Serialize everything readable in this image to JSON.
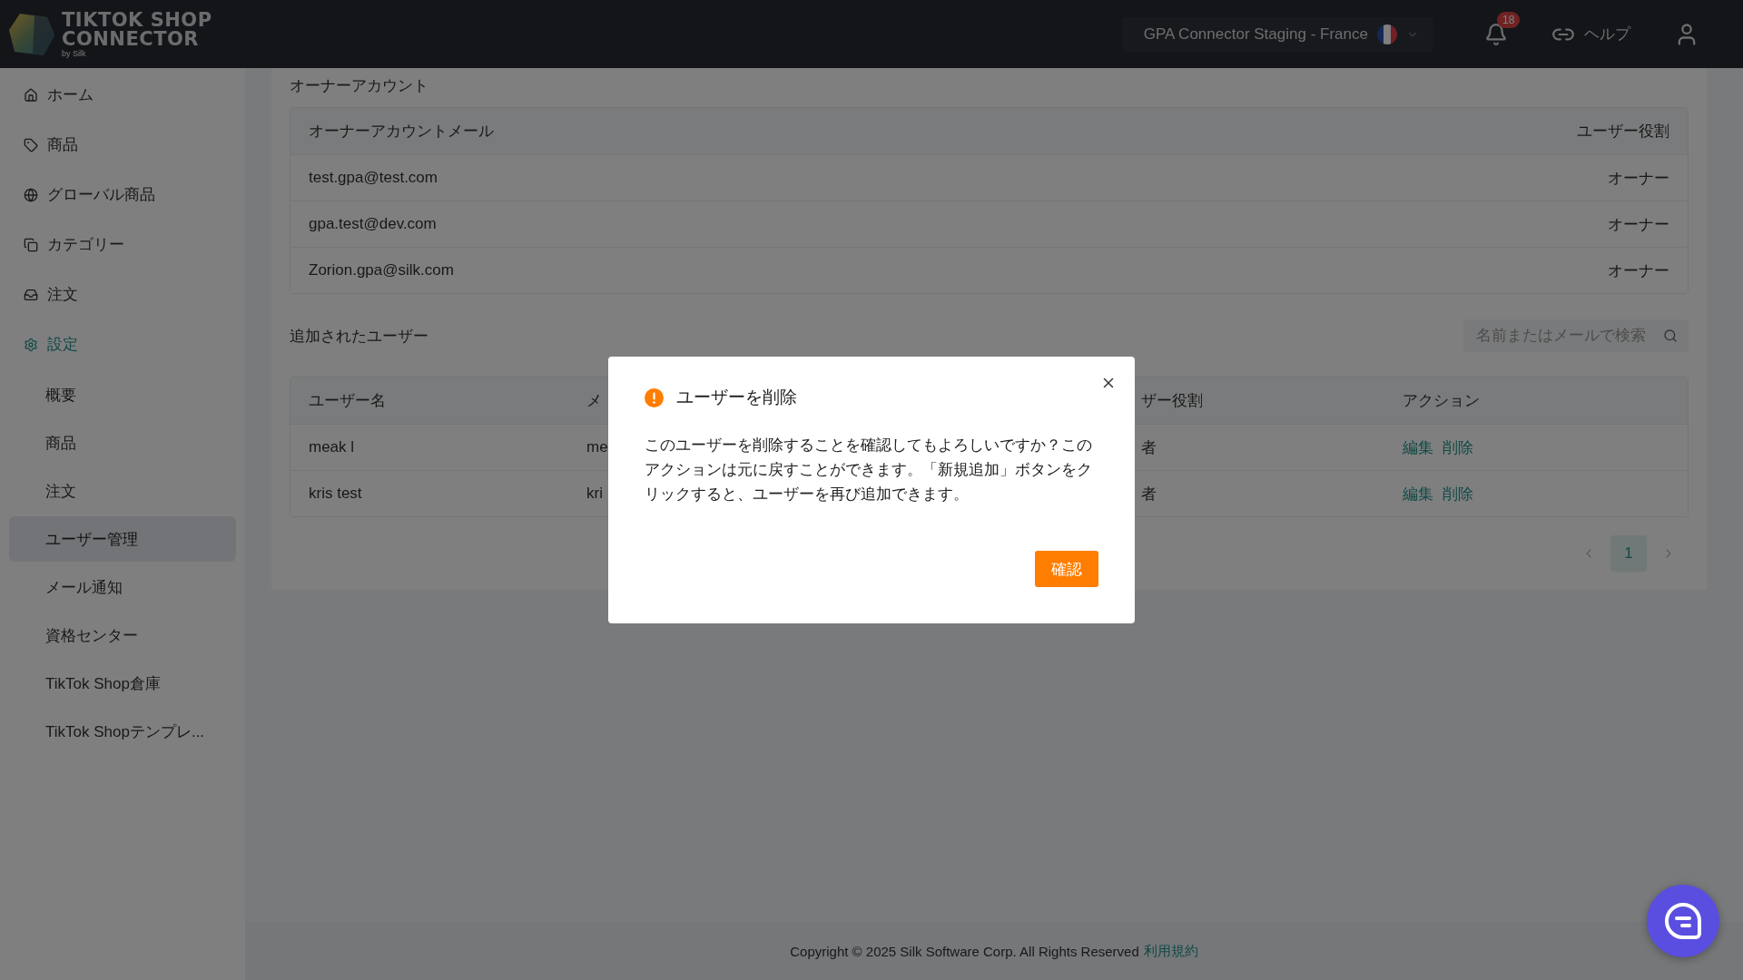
{
  "header": {
    "logo": {
      "line1": "TIKTOK SHOP",
      "line2": "CONNECTOR",
      "tagline": "by Silk"
    },
    "store_selector": {
      "name": "GPA Connector Staging",
      "separator": "-",
      "country": "France"
    },
    "notifications": {
      "count": "18"
    },
    "help": {
      "label": "ヘルプ"
    }
  },
  "sidebar": {
    "items": [
      {
        "label": "ホーム",
        "selected": false
      },
      {
        "label": "商品",
        "selected": false
      },
      {
        "label": "グローバル商品",
        "selected": false
      },
      {
        "label": "カテゴリー",
        "selected": false
      },
      {
        "label": "注文",
        "selected": false
      },
      {
        "label": "設定",
        "selected": true,
        "children": [
          {
            "label": "概要",
            "selected": false
          },
          {
            "label": "商品",
            "selected": false
          },
          {
            "label": "注文",
            "selected": false
          },
          {
            "label": "ユーザー管理",
            "selected": true
          },
          {
            "label": "メール通知",
            "selected": false
          },
          {
            "label": "資格センター",
            "selected": false
          },
          {
            "label": "TikTok Shop倉庫",
            "selected": false
          },
          {
            "label": "TikTok Shopテンプレ...",
            "selected": false
          }
        ]
      }
    ]
  },
  "owner_section": {
    "title": "オーナーアカウント",
    "table": {
      "columns": [
        "オーナーアカウントメール",
        "ユーザー役割"
      ],
      "rows": [
        [
          "test.gpa@test.com",
          "オーナー"
        ],
        [
          "gpa.test@dev.com",
          "オーナー"
        ],
        [
          "Zorion.gpa@silk.com",
          "オーナー"
        ]
      ]
    }
  },
  "users_section": {
    "title": "追加されたユーザー",
    "search": {
      "placeholder": "名前またはメールで検索"
    },
    "table": {
      "columns": [
        "ユーザー名",
        "メ",
        "ザー役割",
        "アクション"
      ],
      "rows": [
        {
          "cells": [
            "meak l",
            "me",
            "者"
          ],
          "actions": [
            "編集",
            "削除"
          ]
        },
        {
          "cells": [
            "kris test",
            "kri",
            "者"
          ],
          "actions": [
            "編集",
            "削除"
          ]
        }
      ]
    },
    "pagination": {
      "pages": [
        {
          "label": "1",
          "selected": true
        }
      ]
    }
  },
  "dialog": {
    "title": "ユーザーを削除",
    "message": "このユーザーを削除することを確認してもよろしいですか？このアクションは元に戻すことができます。「新規追加」ボタンをクリックすると、ユーザーを再び追加できます。",
    "confirm": "確認"
  },
  "footer": {
    "copyright": "Copyright © 2025 Silk Software Corp. All Rights Reserved",
    "link": "利用規約"
  }
}
